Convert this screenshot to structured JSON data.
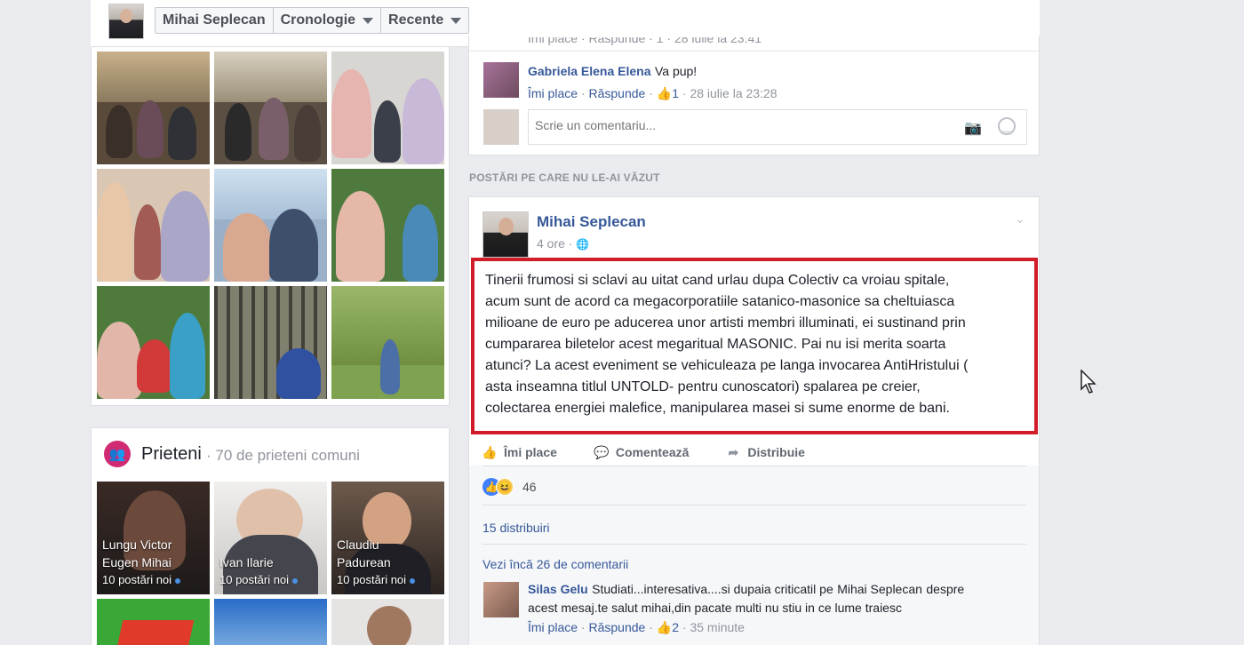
{
  "topbar": {
    "profile_name": "Mihai Seplecan",
    "nav": [
      "Mihai Seplecan",
      "Cronologie",
      "Recente"
    ]
  },
  "friends": {
    "title": "Prieteni",
    "subtitle": "· 70 de prieteni comuni",
    "items": [
      {
        "name_line1": "Lungu Victor",
        "name_line2": "Eugen Mihai",
        "posts": "10 postări noi"
      },
      {
        "name_line1": "Ivan Ilarie",
        "name_line2": "",
        "posts": "10 postări noi"
      },
      {
        "name_line1": "Claudiu",
        "name_line2": "Padurean",
        "posts": "10 postări noi"
      }
    ]
  },
  "comments_top": {
    "partial_row": "Îmi place · Răspunde · 1 · 28 iulie la 23:41",
    "comment": {
      "author": "Gabriela Elena Elena",
      "text": "Va pup!",
      "like": "Îmi place",
      "reply": "Răspunde",
      "likes": "1",
      "time": "28 iulie la 23:28"
    },
    "write_placeholder": "Scrie un comentariu..."
  },
  "unseen_header": "POSTĂRI PE CARE NU LE-AI VĂZUT",
  "post": {
    "author": "Mihai Seplecan",
    "time": "4 ore",
    "lines": [
      "Tinerii frumosi si sclavi au uitat cand urlau dupa Colectiv ca vroiau spitale,",
      "acum sunt de acord ca megacorporatiile satanico-masonice sa cheltuiasca",
      "milioane de euro pe aducerea unor artisti membri illuminati, ei sustinand prin",
      "cumpararea biletelor acest megaritual MASONIC. Pai nu isi merita soarta",
      "atunci? La acest eveniment se vehiculeaza pe langa invocarea AntiHristului (",
      "asta inseamna titlul UNTOLD- pentru cunoscatori) spalarea pe creier,",
      "colectarea energiei malefice, manipularea masei si sume enorme de bani."
    ],
    "actions": {
      "like": "Îmi place",
      "comment": "Comentează",
      "share": "Distribuie"
    },
    "reactions_count": "46",
    "shares": "15 distribuiri",
    "more_comments": "Vezi încă 26 de comentarii",
    "comment": {
      "author": "Silas Gelu",
      "text_before": "Studiati...interesativa....si dupaia criticatil pe",
      "mention": "Mihai Seplecan",
      "text_after": "despre",
      "line2": "acest mesaj.te salut mihai,din pacate multi nu stiu in ce lume traiesc",
      "like": "Îmi place",
      "reply": "Răspunde",
      "likes": "2",
      "time": "35 minute"
    }
  },
  "colors": {
    "background": "#e9ebee",
    "link": "#365899",
    "highlight_border": "#d11d2a",
    "muted": "#90949c"
  }
}
